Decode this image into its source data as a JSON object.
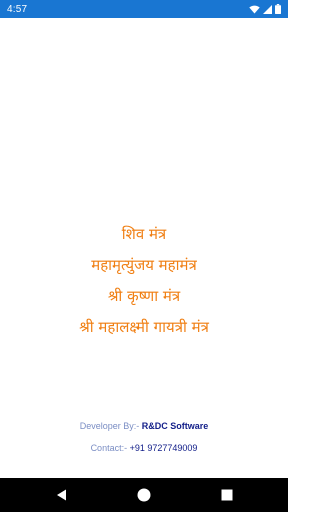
{
  "status_bar": {
    "time": "4:57",
    "icons": [
      "wifi-icon",
      "signal-icon",
      "battery-icon"
    ]
  },
  "menu": {
    "items": [
      {
        "label": "शिव मंत्र"
      },
      {
        "label": "महामृत्युंजय महामंत्र"
      },
      {
        "label": "श्री कृष्णा मंत्र"
      },
      {
        "label": "श्री महालक्ष्मी गायत्री मंत्र"
      }
    ]
  },
  "credits": {
    "developer_label": "Developer By:-",
    "developer_name": "R&DC Software",
    "contact_label": "Contact:-",
    "contact_number": "+91 9727749009"
  },
  "nav_bar": {
    "icons": [
      "back-icon",
      "home-icon",
      "recents-icon"
    ]
  },
  "colors": {
    "status_bar": "#1976d2",
    "menu_text": "#f07f13",
    "credit_label": "#7b8ec4",
    "credit_value": "#14208a",
    "nav_bar": "#000000"
  }
}
